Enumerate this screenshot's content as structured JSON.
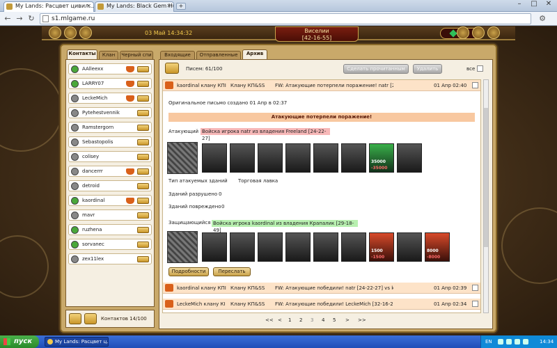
{
  "browser": {
    "tabs": [
      {
        "label": "My Lands: Расцвет цивил..."
      },
      {
        "label": "My Lands: Black Gem Hunti..."
      }
    ],
    "url": "s1.mlgame.ru"
  },
  "game": {
    "datetime": "03 Май 14:34:32",
    "city_name": "Виселии",
    "city_coords": "[42-16-55]",
    "gems": "75"
  },
  "left_tabs": [
    "Контакты",
    "Клан",
    "Черный спи"
  ],
  "contacts": [
    {
      "name": "AAlleexx",
      "online": true,
      "crown": true
    },
    {
      "name": "LARRY07",
      "online": true,
      "crown": true
    },
    {
      "name": "LeckeMich",
      "online": false,
      "crown": true
    },
    {
      "name": "Pytehestvennik",
      "online": false,
      "crown": false
    },
    {
      "name": "Ramstergorn",
      "online": false,
      "crown": false
    },
    {
      "name": "Sebastopolis",
      "online": false,
      "crown": false
    },
    {
      "name": "colisey",
      "online": false,
      "crown": false
    },
    {
      "name": "dancerrr",
      "online": false,
      "crown": true
    },
    {
      "name": "detroid",
      "online": false,
      "crown": false
    },
    {
      "name": "kaordinal",
      "online": true,
      "crown": true
    },
    {
      "name": "mavr",
      "online": false,
      "crown": false
    },
    {
      "name": "ruzhena",
      "online": true,
      "crown": false
    },
    {
      "name": "sorvanec",
      "online": true,
      "crown": false
    },
    {
      "name": "zex11lex",
      "online": false,
      "crown": false
    }
  ],
  "contacts_count": "Контактов 14/100",
  "right_tabs": [
    "Входящие",
    "Отправленные",
    "Архив"
  ],
  "toolbar": {
    "letters_count": "Писем: 61/100",
    "make_unread": "Сделать прочитанным",
    "delete": "Удалить",
    "all": "все"
  },
  "messages": [
    {
      "from": "kaordinal клану КПI",
      "clan": "Клану КП&SS",
      "subject": "FW: Атакующие потерпели поражение! natr [24-22-27]...",
      "date": "01 Апр 02:40"
    },
    {
      "from": "kaordinal клану КПI",
      "clan": "Клану КП&SS",
      "subject": "FW: Атакующие победили! natr [24-22-27] vs kaordinal...",
      "date": "01 Апр 02:39"
    },
    {
      "from": "LeckeMich клану КI",
      "clan": "Клану КП&SS",
      "subject": "FW: Атакующие победили! LeckeMich [32-16-20] vs va...",
      "date": "01 Апр 02:34"
    }
  ],
  "detail": {
    "original_note": "Оригинальное письмо создано 01 Апр в 02:37",
    "banner": "Атакующие потерпели поражение!",
    "attacker_label": "Атакующий",
    "attacker_text": "Войска игрока natr из владения Freeland [24-22-27]",
    "attack_hp": "35000",
    "attack_loss": "-35000",
    "building_type_label": "Тип атакуемых зданий",
    "building_type_value": "Торговая лавка",
    "destroyed_label": "Зданий разрушено",
    "destroyed_value": "0",
    "damaged_label": "Зданий повреждено",
    "damaged_value": "0",
    "defender_label": "Защищающийся",
    "defender_text": "Войска игрока kaordinal из владения Крапалик [29-18-49]",
    "def_hp1": "1500",
    "def_loss1": "-1500",
    "def_hp2": "8000",
    "def_loss2": "-8000",
    "details_btn": "Подробности",
    "forward_btn": "Переслать"
  },
  "pager": [
    "<<",
    "<",
    "1",
    "2",
    "3",
    "4",
    "5",
    ">",
    ">>"
  ],
  "taskbar": {
    "start": "пуск",
    "item": "My Lands: Расцвет ц...",
    "lang": "EN",
    "clock": "14:34"
  }
}
